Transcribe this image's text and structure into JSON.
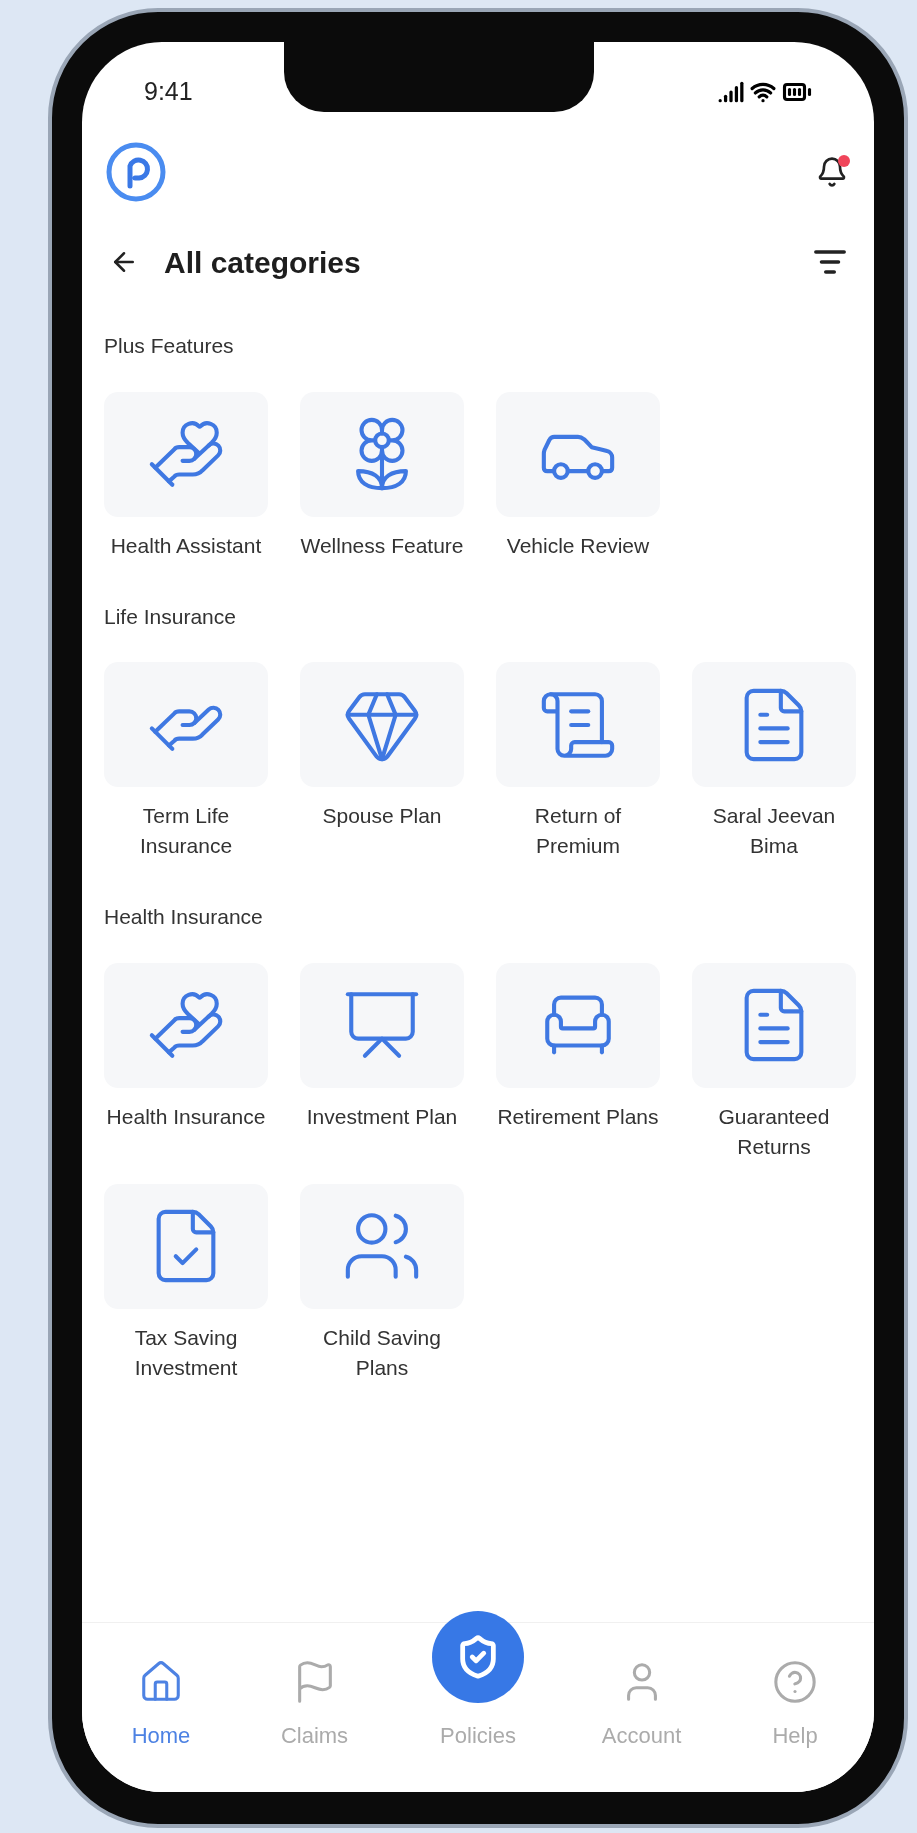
{
  "status_bar": {
    "time": "9:41"
  },
  "header": {
    "notifications": {
      "unread": true
    }
  },
  "title": "All categories",
  "sections": [
    {
      "title": "Plus Features",
      "items": [
        {
          "label": "Health Assistant"
        },
        {
          "label": "Wellness Feature"
        },
        {
          "label": "Vehicle Review"
        }
      ]
    },
    {
      "title": "Life Insurance",
      "items": [
        {
          "label": "Term Life Insurance"
        },
        {
          "label": "Spouse Plan"
        },
        {
          "label": "Return of Premium"
        },
        {
          "label": "Saral Jeevan Bima"
        }
      ]
    },
    {
      "title": "Health Insurance",
      "items": [
        {
          "label": "Health Insurance"
        },
        {
          "label": "Investment Plan"
        },
        {
          "label": "Retirement Plans"
        },
        {
          "label": "Guaranteed Returns"
        },
        {
          "label": "Tax Saving Investment"
        },
        {
          "label": "Child Saving Plans"
        }
      ]
    }
  ],
  "bottom_nav": [
    {
      "label": "Home",
      "kind": "tab",
      "selected": true
    },
    {
      "label": "Claims",
      "kind": "tab",
      "selected": false
    },
    {
      "label": "Policies",
      "kind": "fab",
      "selected": false
    },
    {
      "label": "Account",
      "kind": "tab",
      "selected": false
    },
    {
      "label": "Help",
      "kind": "tab",
      "selected": false
    }
  ]
}
